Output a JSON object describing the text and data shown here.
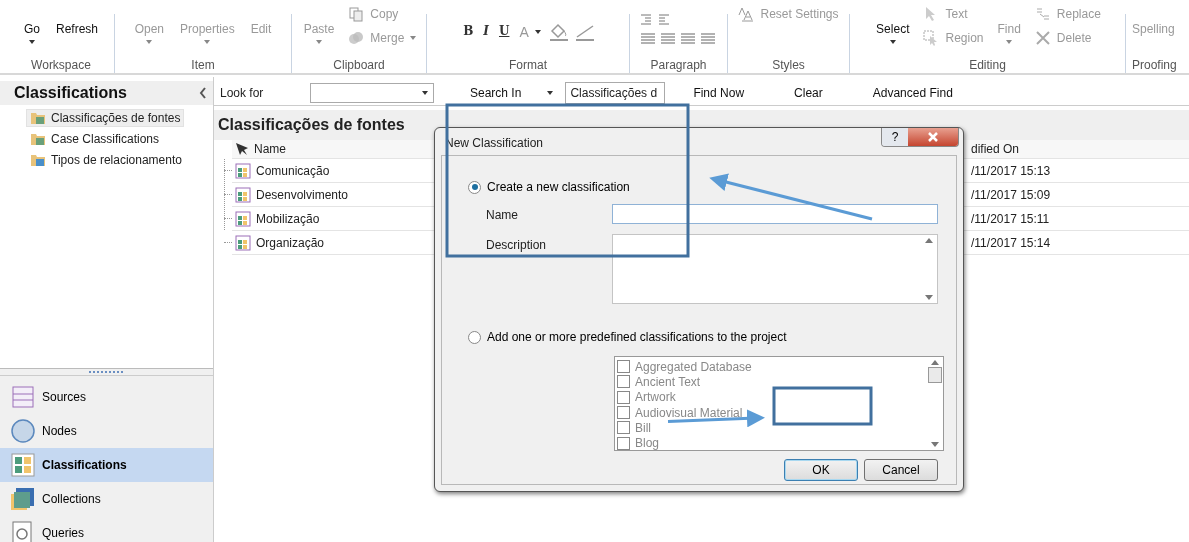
{
  "ribbon": {
    "groups": [
      {
        "label": "Workspace",
        "items": [
          {
            "kind": "large",
            "label": "Go",
            "disabled": false,
            "dropdown": true
          },
          {
            "kind": "large",
            "label": "Refresh",
            "disabled": false,
            "dropdown": false
          }
        ]
      },
      {
        "label": "Item",
        "items": [
          {
            "kind": "large",
            "label": "Open",
            "disabled": true,
            "dropdown": true
          },
          {
            "kind": "large",
            "label": "Properties",
            "disabled": true,
            "dropdown": true
          },
          {
            "kind": "large",
            "label": "Edit",
            "disabled": true,
            "dropdown": false
          }
        ]
      },
      {
        "label": "Clipboard",
        "items": [
          {
            "kind": "large",
            "label": "Paste",
            "disabled": true,
            "dropdown": true
          },
          {
            "kind": "stack",
            "buttons": [
              {
                "kind": "copy",
                "label": "Copy",
                "disabled": true,
                "dropdown": false
              },
              {
                "kind": "merge",
                "label": "Merge",
                "disabled": true,
                "dropdown": true
              }
            ]
          }
        ]
      },
      {
        "label": "Format",
        "items": [
          {
            "kind": "bold",
            "label": "B"
          },
          {
            "kind": "italic",
            "label": "I"
          },
          {
            "kind": "underline",
            "label": "U"
          },
          {
            "kind": "fontcolor",
            "label": "A",
            "dropdown": true
          },
          {
            "kind": "fill"
          },
          {
            "kind": "line"
          }
        ]
      },
      {
        "label": "Paragraph",
        "items": [
          {
            "kind": "paragraph"
          }
        ]
      },
      {
        "label": "Styles",
        "items": [
          {
            "kind": "stack",
            "buttons": [
              {
                "kind": "reset",
                "label": "Reset Settings",
                "disabled": true,
                "dropdown": false
              }
            ]
          }
        ]
      },
      {
        "label": "Editing",
        "items": [
          {
            "kind": "large",
            "label": "Select",
            "disabled": false,
            "dropdown": true
          },
          {
            "kind": "stack",
            "buttons": [
              {
                "kind": "pointer",
                "label": "Text",
                "disabled": true,
                "dropdown": false
              },
              {
                "kind": "region",
                "label": "Region",
                "disabled": true,
                "dropdown": false
              }
            ]
          },
          {
            "kind": "large",
            "label": "Find",
            "disabled": true,
            "dropdown": true
          },
          {
            "kind": "stack",
            "buttons": [
              {
                "kind": "replace",
                "label": "Replace",
                "disabled": true,
                "dropdown": false
              },
              {
                "kind": "delete",
                "label": "Delete",
                "disabled": true,
                "dropdown": false
              }
            ]
          }
        ]
      },
      {
        "label": "Proofing",
        "items": [
          {
            "kind": "large",
            "label": "Spelling",
            "disabled": true,
            "dropdown": false
          }
        ]
      }
    ]
  },
  "sidebar": {
    "title": "Classifications",
    "tree": [
      {
        "label": "Classificações de fontes",
        "selected": true
      },
      {
        "label": "Case Classifications",
        "selected": false
      },
      {
        "label": "Tipos de relacionamento",
        "selected": false
      }
    ],
    "nav": [
      {
        "label": "Sources",
        "selected": false
      },
      {
        "label": "Nodes",
        "selected": false
      },
      {
        "label": "Classifications",
        "selected": true
      },
      {
        "label": "Collections",
        "selected": false
      },
      {
        "label": "Queries",
        "selected": false
      }
    ]
  },
  "search_bar": {
    "look_for_label": "Look for",
    "search_in_label": "Search In",
    "search_in_value": "Classificações d",
    "buttons": [
      "Find Now",
      "Clear",
      "Advanced Find"
    ]
  },
  "content": {
    "title": "Classificações de fontes",
    "columns": [
      "Name",
      "dified On"
    ],
    "rows": [
      {
        "name": "Comunicação",
        "modified": "/11/2017 15:13"
      },
      {
        "name": "Desenvolvimento",
        "modified": "/11/2017 15:09"
      },
      {
        "name": "Mobilização",
        "modified": "/11/2017 15:11"
      },
      {
        "name": "Organização",
        "modified": "/11/2017 15:14"
      }
    ]
  },
  "dialog": {
    "title": "New Classification",
    "help_label": "?",
    "options": [
      {
        "label": "Create a new classification",
        "selected": true
      },
      {
        "label": "Add one or more predefined classifications to the project",
        "selected": false
      }
    ],
    "name_label": "Name",
    "description_label": "Description",
    "predefined_disabled": true,
    "predefined": [
      {
        "label": "Aggregated Database",
        "checked": false
      },
      {
        "label": "Ancient Text",
        "checked": false
      },
      {
        "label": "Artwork",
        "checked": false
      },
      {
        "label": "Audiovisual Material",
        "checked": false
      },
      {
        "label": "Bill",
        "checked": false
      },
      {
        "label": "Blog",
        "checked": false
      }
    ],
    "buttons": [
      "OK",
      "Cancel"
    ]
  }
}
